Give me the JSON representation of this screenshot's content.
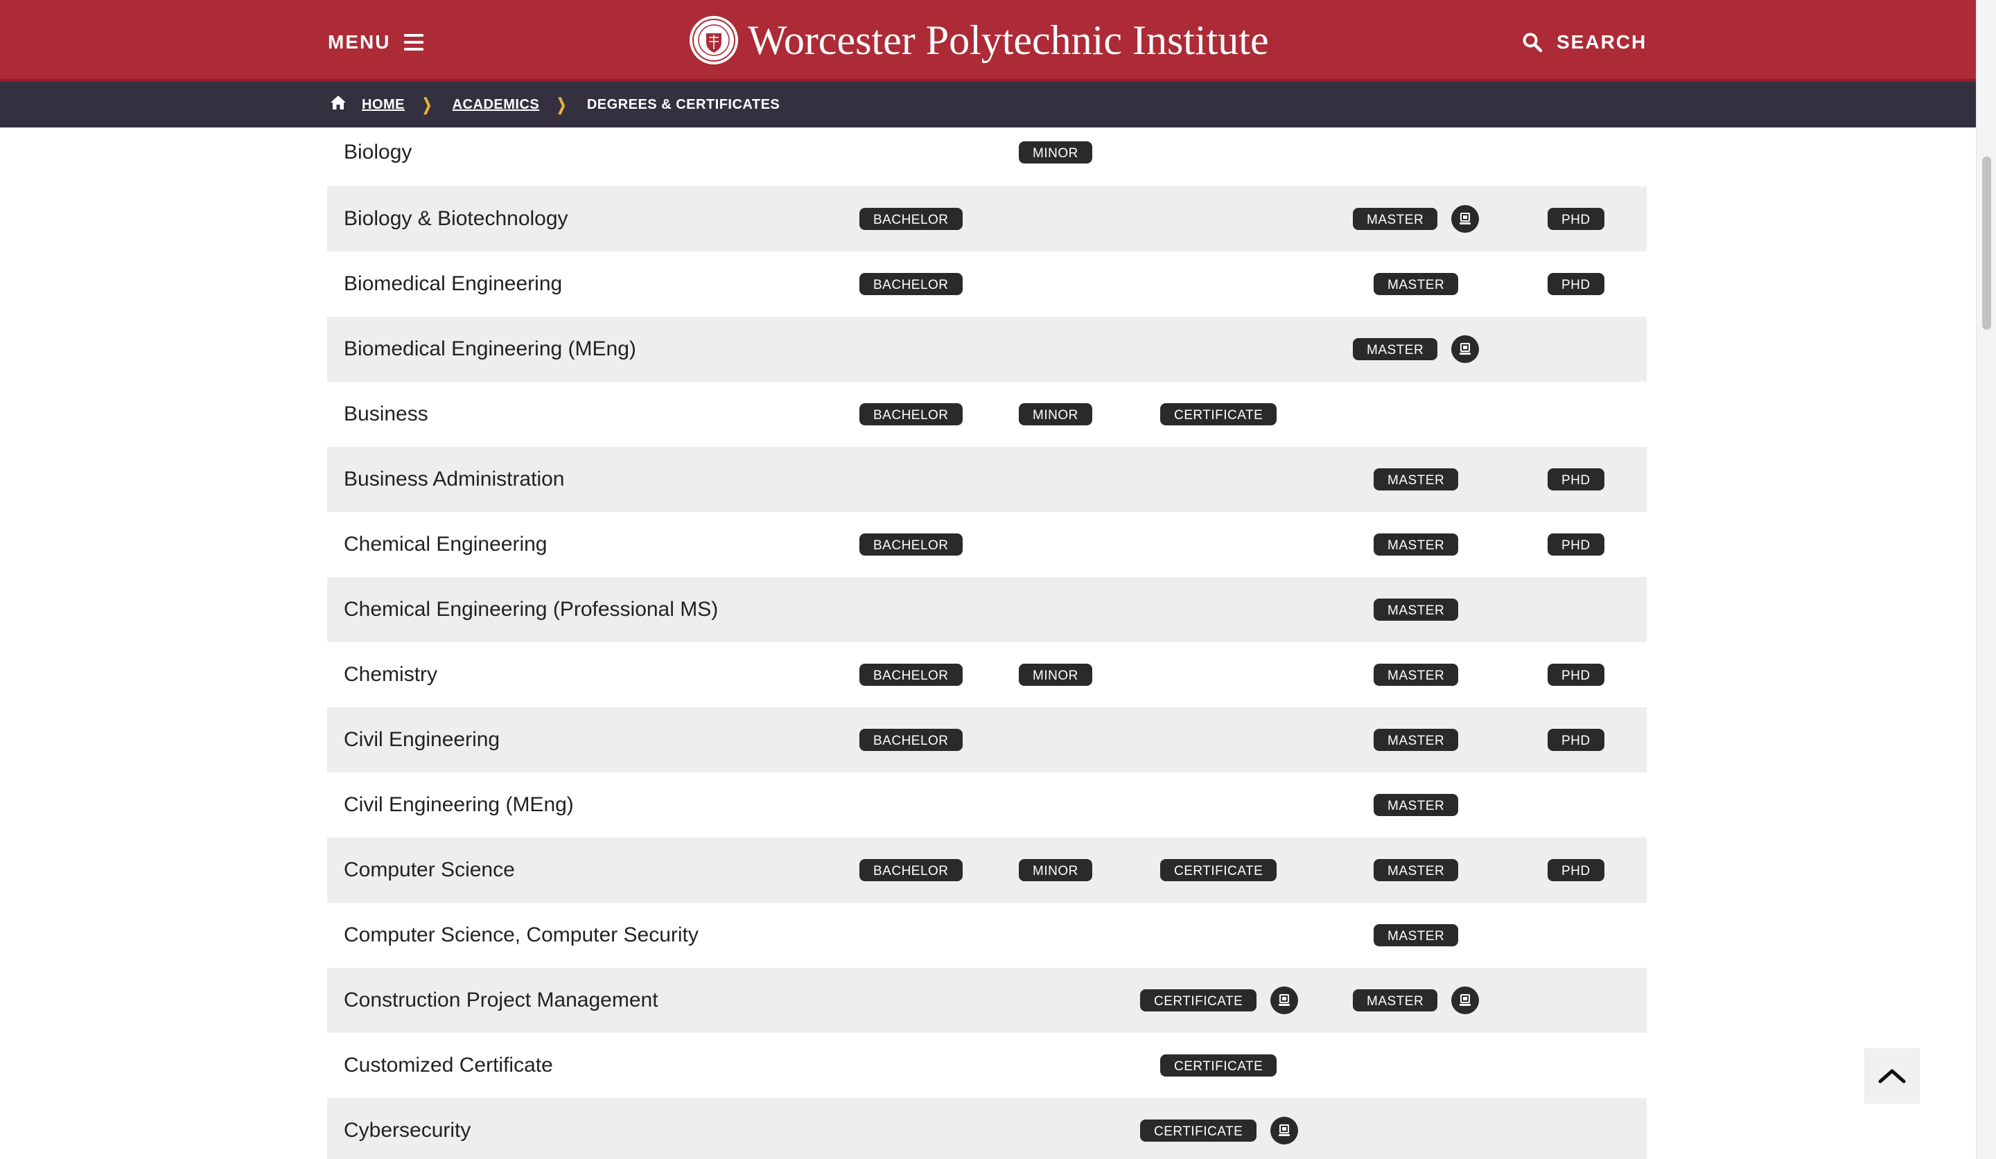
{
  "header": {
    "menu_label": "MENU",
    "site_title": "Worcester Polytechnic Institute",
    "search_label": "SEARCH",
    "brand_color": "#ac2b37",
    "icons": {
      "menu": "hamburger-icon",
      "search": "search-icon",
      "logo": "wpi-seal-icon"
    }
  },
  "breadcrumb": {
    "home": "HOME",
    "academics": "ACADEMICS",
    "current": "DEGREES & CERTIFICATES",
    "bar_color": "#34303f",
    "separator_color": "#e6b43a"
  },
  "programs": [
    {
      "name": "Biology",
      "bachelor": "",
      "minor": "MINOR",
      "certificate": "",
      "certificate_online": false,
      "master": "",
      "master_online": false,
      "phd": ""
    },
    {
      "name": "Biology & Biotechnology",
      "bachelor": "BACHELOR",
      "minor": "",
      "certificate": "",
      "certificate_online": false,
      "master": "MASTER",
      "master_online": true,
      "phd": "PHD"
    },
    {
      "name": "Biomedical Engineering",
      "bachelor": "BACHELOR",
      "minor": "",
      "certificate": "",
      "certificate_online": false,
      "master": "MASTER",
      "master_online": false,
      "phd": "PHD"
    },
    {
      "name": "Biomedical Engineering (MEng)",
      "bachelor": "",
      "minor": "",
      "certificate": "",
      "certificate_online": false,
      "master": "MASTER",
      "master_online": true,
      "phd": ""
    },
    {
      "name": "Business",
      "bachelor": "BACHELOR",
      "minor": "MINOR",
      "certificate": "CERTIFICATE",
      "certificate_online": false,
      "master": "",
      "master_online": false,
      "phd": ""
    },
    {
      "name": "Business Administration",
      "bachelor": "",
      "minor": "",
      "certificate": "",
      "certificate_online": false,
      "master": "MASTER",
      "master_online": false,
      "phd": "PHD"
    },
    {
      "name": "Chemical Engineering",
      "bachelor": "BACHELOR",
      "minor": "",
      "certificate": "",
      "certificate_online": false,
      "master": "MASTER",
      "master_online": false,
      "phd": "PHD"
    },
    {
      "name": "Chemical Engineering (Professional MS)",
      "bachelor": "",
      "minor": "",
      "certificate": "",
      "certificate_online": false,
      "master": "MASTER",
      "master_online": false,
      "phd": ""
    },
    {
      "name": "Chemistry",
      "bachelor": "BACHELOR",
      "minor": "MINOR",
      "certificate": "",
      "certificate_online": false,
      "master": "MASTER",
      "master_online": false,
      "phd": "PHD"
    },
    {
      "name": "Civil Engineering",
      "bachelor": "BACHELOR",
      "minor": "",
      "certificate": "",
      "certificate_online": false,
      "master": "MASTER",
      "master_online": false,
      "phd": "PHD"
    },
    {
      "name": "Civil Engineering (MEng)",
      "bachelor": "",
      "minor": "",
      "certificate": "",
      "certificate_online": false,
      "master": "MASTER",
      "master_online": false,
      "phd": ""
    },
    {
      "name": "Computer Science",
      "bachelor": "BACHELOR",
      "minor": "MINOR",
      "certificate": "CERTIFICATE",
      "certificate_online": false,
      "master": "MASTER",
      "master_online": false,
      "phd": "PHD"
    },
    {
      "name": "Computer Science, Computer Security",
      "bachelor": "",
      "minor": "",
      "certificate": "",
      "certificate_online": false,
      "master": "MASTER",
      "master_online": false,
      "phd": ""
    },
    {
      "name": "Construction Project Management",
      "bachelor": "",
      "minor": "",
      "certificate": "CERTIFICATE",
      "certificate_online": true,
      "master": "MASTER",
      "master_online": true,
      "phd": ""
    },
    {
      "name": "Customized Certificate",
      "bachelor": "",
      "minor": "",
      "certificate": "CERTIFICATE",
      "certificate_online": false,
      "master": "",
      "master_online": false,
      "phd": ""
    },
    {
      "name": "Cybersecurity",
      "bachelor": "",
      "minor": "",
      "certificate": "CERTIFICATE",
      "certificate_online": true,
      "master": "",
      "master_online": false,
      "phd": ""
    }
  ],
  "online_icon": "laptop-icon",
  "back_to_top_icon": "chevron-up-icon"
}
